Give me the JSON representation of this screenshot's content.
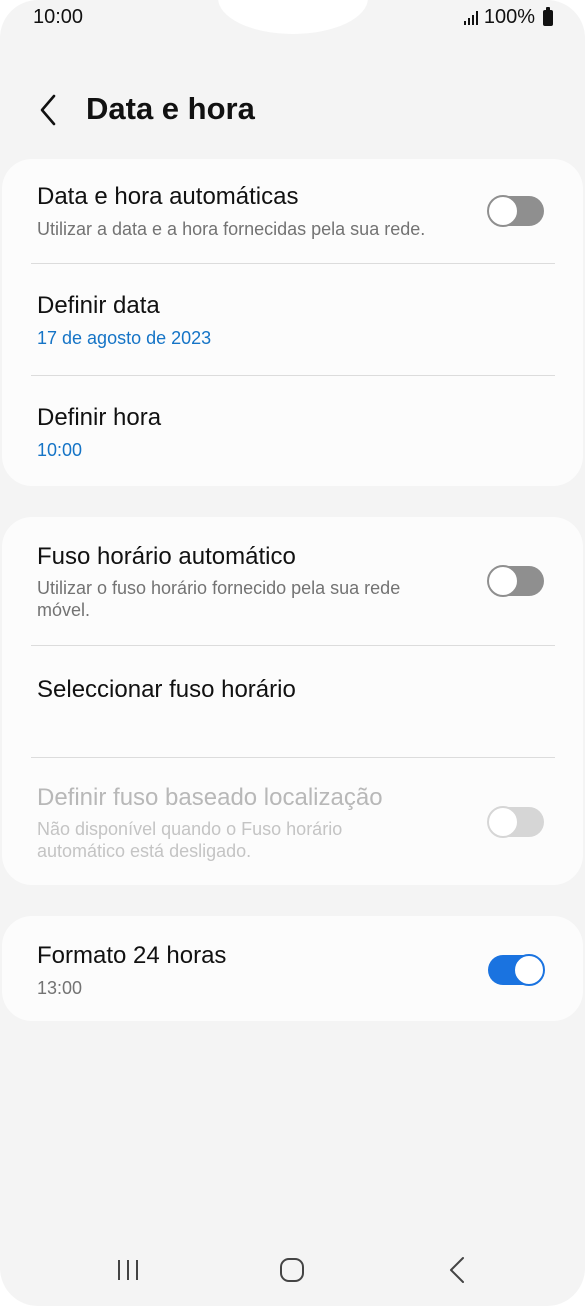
{
  "status_bar": {
    "time": "10:00",
    "battery": "100%"
  },
  "header": {
    "back_icon": "chevron-left-icon",
    "title": "Data e hora"
  },
  "group1": {
    "auto_datetime": {
      "title": "Data e hora automáticas",
      "subtitle": "Utilizar a data e a hora fornecidas pela sua rede.",
      "enabled": false
    },
    "set_date": {
      "title": "Definir data",
      "value": "17 de agosto de 2023"
    },
    "set_time": {
      "title": "Definir hora",
      "value": "10:00"
    }
  },
  "group2": {
    "auto_timezone": {
      "title": "Fuso horário automático",
      "subtitle": "Utilizar o fuso horário fornecido pela sua rede móvel.",
      "enabled": false
    },
    "select_timezone": {
      "title": "Seleccionar fuso horário"
    },
    "location_timezone": {
      "title": "Definir fuso baseado localização",
      "subtitle": "Não disponível quando o Fuso horário automático está desligado.",
      "enabled": false,
      "disabled": true
    }
  },
  "group3": {
    "format_24h": {
      "title": "Formato 24 horas",
      "subtitle": "13:00",
      "enabled": true
    }
  },
  "nav_bar": {
    "recents_icon": "recents-icon",
    "home_icon": "home-icon",
    "back_icon": "back-icon"
  },
  "colors": {
    "accent": "#1a73e0",
    "link": "#1574c6",
    "background": "#f4f4f4",
    "card": "#fcfcfc"
  }
}
